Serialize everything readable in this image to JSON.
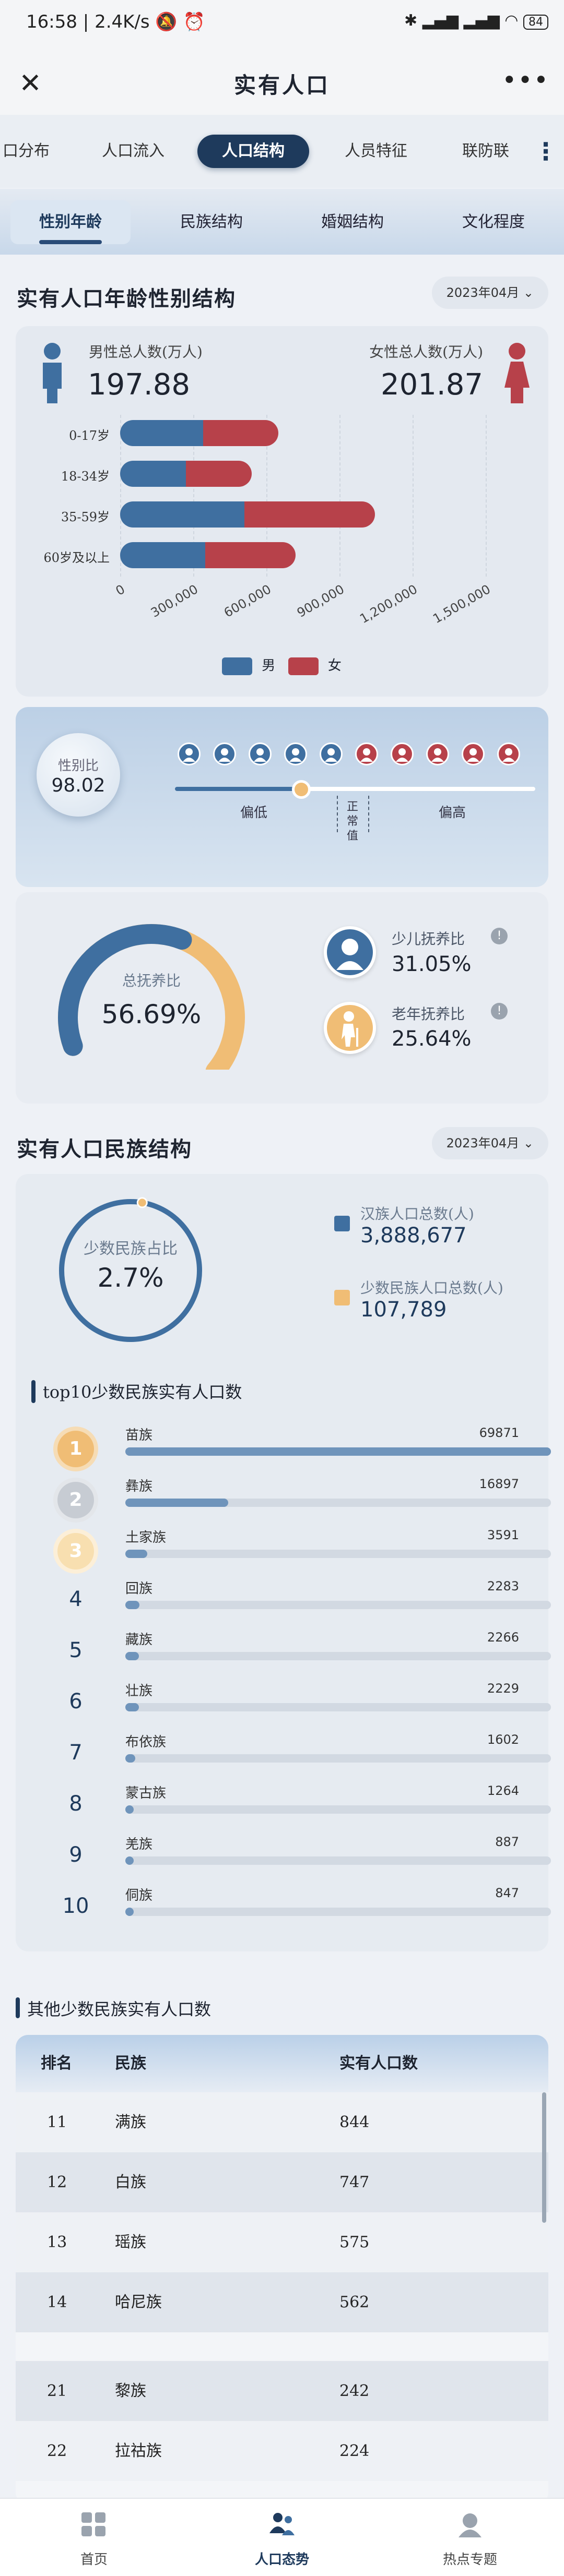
{
  "status_bar": {
    "time": "16:58",
    "speed": "2.4K/s",
    "battery": "84"
  },
  "title_bar": {
    "title": "实有人口"
  },
  "main_tabs": [
    "口分布",
    "人口流入",
    "人口结构",
    "人员特征",
    "联防联"
  ],
  "main_tabs_active": 2,
  "sub_tabs": [
    "性别年龄",
    "民族结构",
    "婚姻结构",
    "文化程度"
  ],
  "sub_tabs_active": 0,
  "gender_section": {
    "title": "实有人口年龄性别结构",
    "date": "2023年04月",
    "male_label": "男性总人数(万人)",
    "male_value": "197.88",
    "female_label": "女性总人数(万人)",
    "female_value": "201.87",
    "legend_male": "男",
    "legend_female": "女",
    "colors": {
      "male": "#3f6fa0",
      "female": "#b7414a"
    }
  },
  "chart_data": {
    "type": "bar",
    "orientation": "horizontal",
    "stacked": true,
    "categories": [
      "0-17岁",
      "18-34岁",
      "35-59岁",
      "60岁及以上"
    ],
    "series": [
      {
        "name": "男",
        "values": [
          340000,
          270000,
          510000,
          350000
        ]
      },
      {
        "name": "女",
        "values": [
          310000,
          270000,
          535000,
          370000
        ]
      }
    ],
    "x_ticks": [
      "0",
      "300,000",
      "600,000",
      "900,000",
      "1,200,000",
      "1,500,000"
    ],
    "xlim": [
      0,
      1500000
    ],
    "legend": "bottom"
  },
  "sex_ratio": {
    "label": "性别比",
    "value": "98.02",
    "low": "偏低",
    "normal": "正常值",
    "high": "偏高",
    "persons": [
      "male",
      "male",
      "male",
      "male",
      "male",
      "female",
      "female",
      "female",
      "female",
      "female"
    ],
    "marker_fraction": 0.35
  },
  "dependency": {
    "total_label": "总抚养比",
    "total_value": "56.69%",
    "total_fraction": 0.5669,
    "child_label": "少儿抚养比",
    "child_value": "31.05%",
    "old_label": "老年抚养比",
    "old_value": "25.64%",
    "colors": {
      "child": "#3f6fa0",
      "old": "#f0bd75"
    }
  },
  "ethnic_section": {
    "title": "实有人口民族结构",
    "date": "2023年04月",
    "minority_ratio_label": "少数民族占比",
    "minority_ratio_value": "2.7%",
    "minority_fraction": 0.027,
    "han_label": "汉族人口总数(人)",
    "han_value": "3,888,677",
    "minority_label": "少数民族人口总数(人)",
    "minority_value": "107,789",
    "top10_title": "top10少数民族实有人口数"
  },
  "top10": [
    {
      "rank": "1",
      "name": "苗族",
      "value": 69871
    },
    {
      "rank": "2",
      "name": "彝族",
      "value": 16897
    },
    {
      "rank": "3",
      "name": "土家族",
      "value": 3591
    },
    {
      "rank": "4",
      "name": "回族",
      "value": 2283
    },
    {
      "rank": "5",
      "name": "藏族",
      "value": 2266
    },
    {
      "rank": "6",
      "name": "壮族",
      "value": 2229
    },
    {
      "rank": "7",
      "name": "布依族",
      "value": 1602
    },
    {
      "rank": "8",
      "name": "蒙古族",
      "value": 1264
    },
    {
      "rank": "9",
      "name": "羌族",
      "value": 887
    },
    {
      "rank": "10",
      "name": "侗族",
      "value": 847
    }
  ],
  "other_table": {
    "title": "其他少数民族实有人口数",
    "headers": [
      "排名",
      "民族",
      "实有人口数"
    ],
    "rows": [
      [
        "11",
        "满族",
        "844"
      ],
      [
        "12",
        "白族",
        "747"
      ],
      [
        "13",
        "瑶族",
        "575"
      ],
      [
        "14",
        "哈尼族",
        "562"
      ],
      [
        "",
        "",
        ""
      ],
      [
        "21",
        "黎族",
        "242"
      ],
      [
        "22",
        "拉祜族",
        "224"
      ]
    ]
  },
  "bottom_nav": [
    "首页",
    "人口态势",
    "热点专题"
  ],
  "bottom_nav_active": 1
}
